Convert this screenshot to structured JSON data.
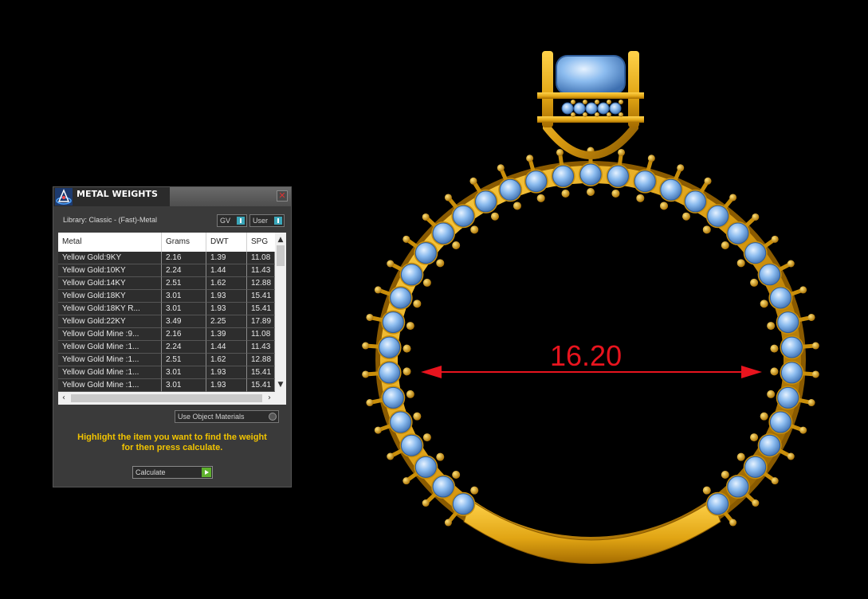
{
  "panel": {
    "title": "METAL WEIGHTS",
    "close_icon": "close-icon",
    "library_label": "Library: Classic - (Fast)-Metal",
    "toggle_gv": "GV",
    "toggle_user": "User",
    "columns": [
      "Metal",
      "Grams",
      "DWT",
      "SPG"
    ],
    "rows": [
      [
        "Yellow Gold:9KY",
        "2.16",
        "1.39",
        "11.08"
      ],
      [
        "Yellow Gold:10KY",
        "2.24",
        "1.44",
        "11.43"
      ],
      [
        "Yellow Gold:14KY",
        "2.51",
        "1.62",
        "12.88"
      ],
      [
        "Yellow Gold:18KY",
        "3.01",
        "1.93",
        "15.41"
      ],
      [
        "Yellow Gold:18KY R...",
        "3.01",
        "1.93",
        "15.41"
      ],
      [
        "Yellow Gold:22KY",
        "3.49",
        "2.25",
        "17.89"
      ],
      [
        "Yellow Gold Mine :9...",
        "2.16",
        "1.39",
        "11.08"
      ],
      [
        "Yellow Gold Mine :1...",
        "2.24",
        "1.44",
        "11.43"
      ],
      [
        "Yellow Gold Mine :1...",
        "2.51",
        "1.62",
        "12.88"
      ],
      [
        "Yellow Gold Mine :1...",
        "3.01",
        "1.93",
        "15.41"
      ],
      [
        "Yellow Gold Mine :1...",
        "3.01",
        "1.93",
        "15.41"
      ]
    ],
    "use_object_materials": "Use Object Materials",
    "hint_line1": "Highlight the item you want to find the weight",
    "hint_line2": "for then press calculate.",
    "calculate_label": "Calculate"
  },
  "viewport": {
    "dimension_value": "16.20",
    "dimension_color": "#e8141e",
    "metal_color": "#e0a81a",
    "stone_color": "#7fb0e6"
  }
}
